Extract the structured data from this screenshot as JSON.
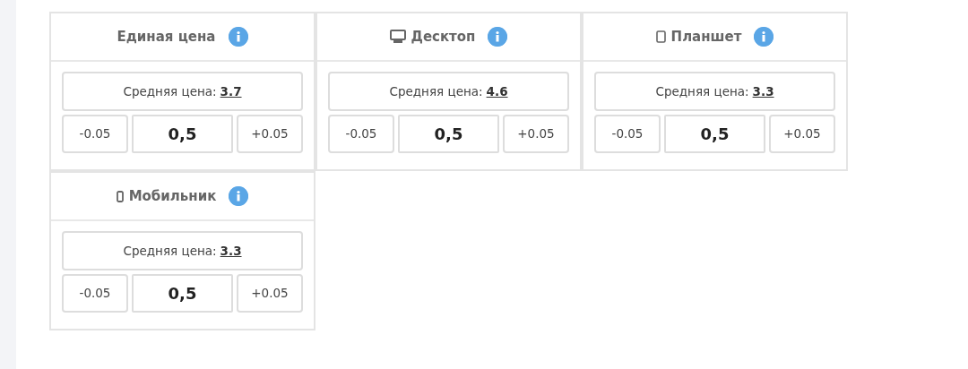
{
  "cards": [
    {
      "title": "Единая цена",
      "kind": "plain",
      "price_label": "Средняя цена:",
      "price_value": "3.7",
      "minus": "-0.05",
      "value": "0,5",
      "plus": "+0.05"
    },
    {
      "title": "Десктоп",
      "kind": "desktop",
      "price_label": "Средняя цена:",
      "price_value": "4.6",
      "minus": "-0.05",
      "value": "0,5",
      "plus": "+0.05"
    },
    {
      "title": "Планшет",
      "kind": "tablet",
      "price_label": "Средняя цена:",
      "price_value": "3.3",
      "minus": "-0.05",
      "value": "0,5",
      "plus": "+0.05"
    },
    {
      "title": "Мобильник",
      "kind": "mobile",
      "price_label": "Средняя цена:",
      "price_value": "3.3",
      "minus": "-0.05",
      "value": "0,5",
      "plus": "+0.05"
    }
  ]
}
